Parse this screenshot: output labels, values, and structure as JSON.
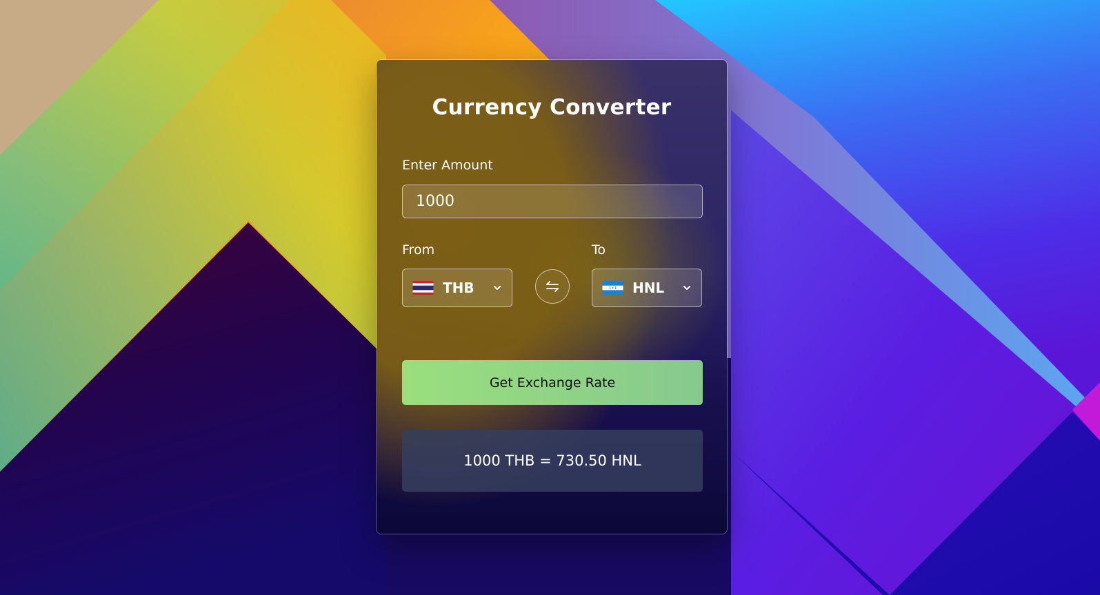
{
  "app": {
    "title": "Currency Converter"
  },
  "amount": {
    "label": "Enter Amount",
    "value": "1000"
  },
  "from": {
    "label": "From",
    "currency": "THB",
    "flag_icon": "thailand-flag-icon"
  },
  "to": {
    "label": "To",
    "currency": "HNL",
    "flag_icon": "honduras-flag-icon"
  },
  "swap": {
    "icon": "swap-arrows-icon"
  },
  "action": {
    "button_label": "Get Exchange Rate"
  },
  "result": {
    "text": "1000 THB = 730.50 HNL"
  },
  "colors": {
    "button": "#94db82",
    "result_bg": "#353e5e",
    "text": "#ffffff"
  }
}
